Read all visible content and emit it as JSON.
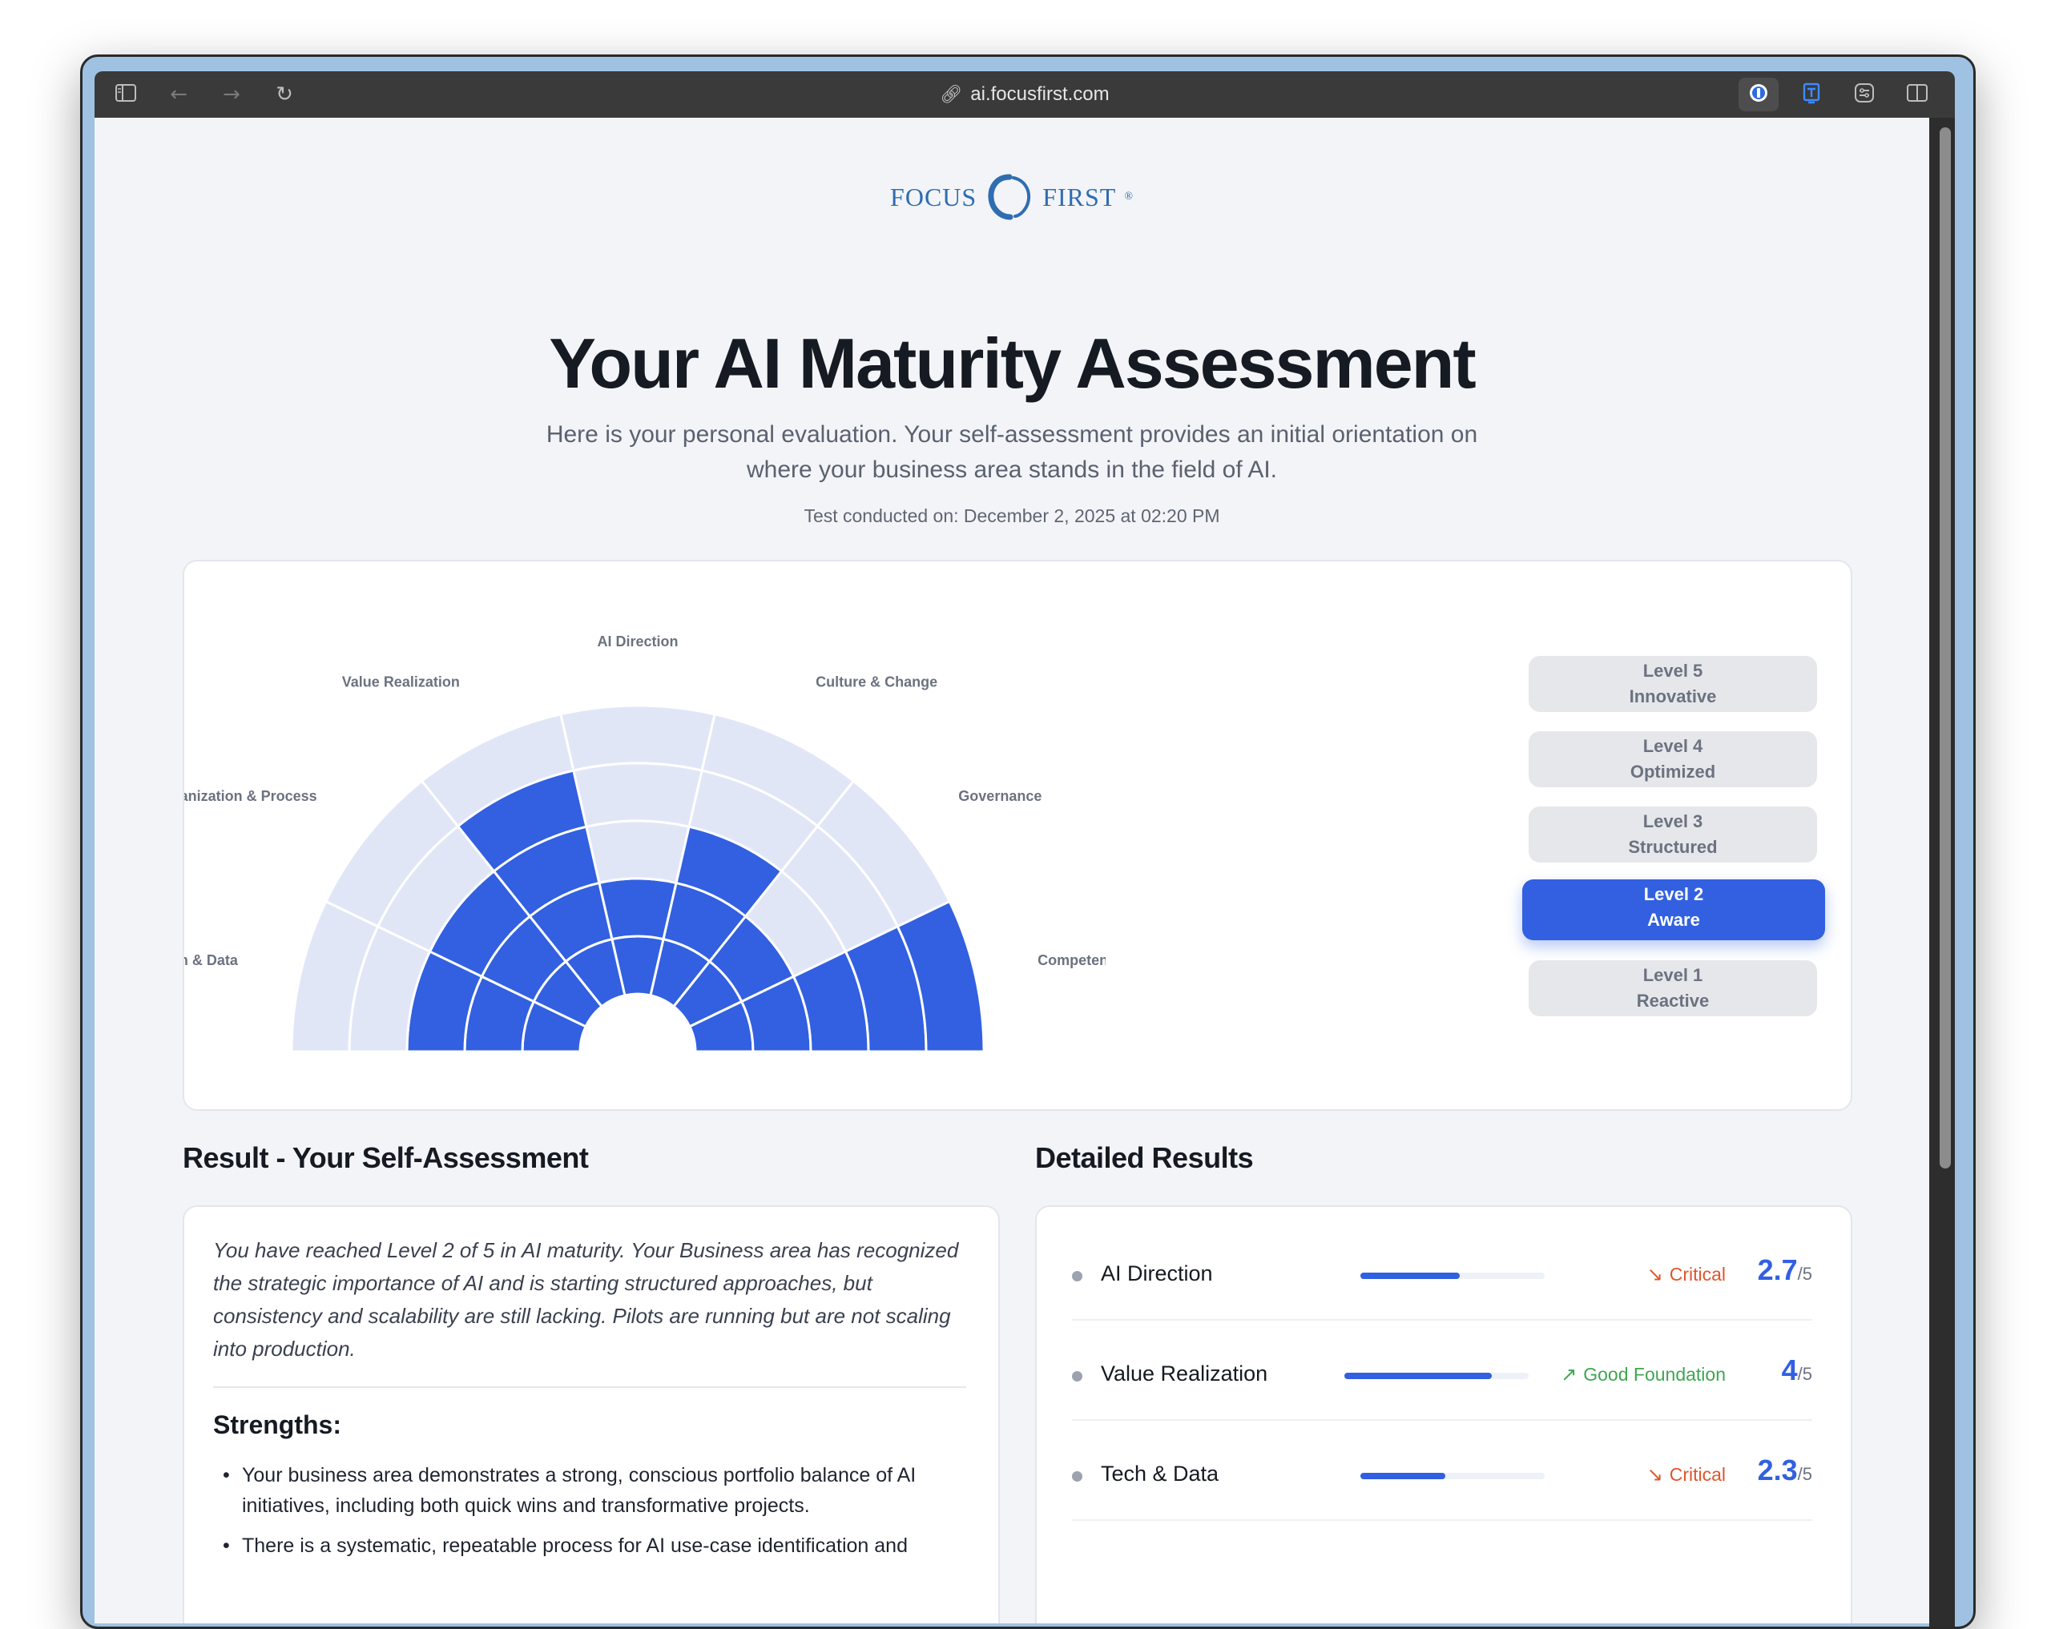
{
  "browser": {
    "url": "ai.focusfirst.com",
    "icons": [
      "sidebar-icon",
      "back-icon",
      "forward-icon",
      "reload-icon",
      "link-icon",
      "password-extension-icon",
      "translate-extension-icon",
      "settings-extension-icon",
      "split-view-icon"
    ]
  },
  "logo": {
    "left": "FOCUS",
    "right": "FIRST",
    "mark": "®"
  },
  "header": {
    "title": "Your AI Maturity Assessment",
    "subtitle": "Here is your personal evaluation. Your self-assessment provides an initial orientation on where your business area stands in the field of AI.",
    "conducted": "Test conducted on: December 2, 2025 at 02:20 PM"
  },
  "chart_data": {
    "type": "polar-area",
    "levels": 5,
    "categories": [
      "Tech & Data",
      "Organization & Process",
      "Value Realization",
      "AI Direction",
      "Culture & Change",
      "Governance",
      "Competency"
    ],
    "values": [
      3,
      3,
      4,
      2,
      3,
      2,
      5
    ],
    "colors": {
      "filled": "#3260e0",
      "empty": "#e1e6f7",
      "grid": "#ffffff"
    }
  },
  "levels": [
    {
      "level": "Level 5",
      "name": "Innovative",
      "active": false
    },
    {
      "level": "Level 4",
      "name": "Optimized",
      "active": false
    },
    {
      "level": "Level 3",
      "name": "Structured",
      "active": false
    },
    {
      "level": "Level 2",
      "name": "Aware",
      "active": true
    },
    {
      "level": "Level 1",
      "name": "Reactive",
      "active": false
    }
  ],
  "result": {
    "heading": "Result - Your Self-Assessment",
    "text": "You have reached Level 2 of 5 in AI maturity. Your Business area has recognized the strategic importance of AI and is starting structured approaches, but consistency and scalability are still lacking. Pilots are running but are not scaling into production.",
    "strengths_title": "Strengths:",
    "strengths": [
      "Your business area demonstrates a strong, conscious portfolio balance of AI initiatives, including both quick wins and transformative projects.",
      "There is a systematic, repeatable process for AI use-case identification and"
    ]
  },
  "details": {
    "heading": "Detailed Results",
    "rows": [
      {
        "name": "AI Direction",
        "fill": 0.54,
        "status": "Critical",
        "status_type": "critical",
        "score": "2.7",
        "denom": "/5"
      },
      {
        "name": "Value Realization",
        "fill": 0.8,
        "status": "Good Foundation",
        "status_type": "good",
        "score": "4",
        "denom": "/5"
      },
      {
        "name": "Tech & Data",
        "fill": 0.46,
        "status": "Critical",
        "status_type": "critical",
        "score": "2.3",
        "denom": "/5"
      }
    ]
  }
}
